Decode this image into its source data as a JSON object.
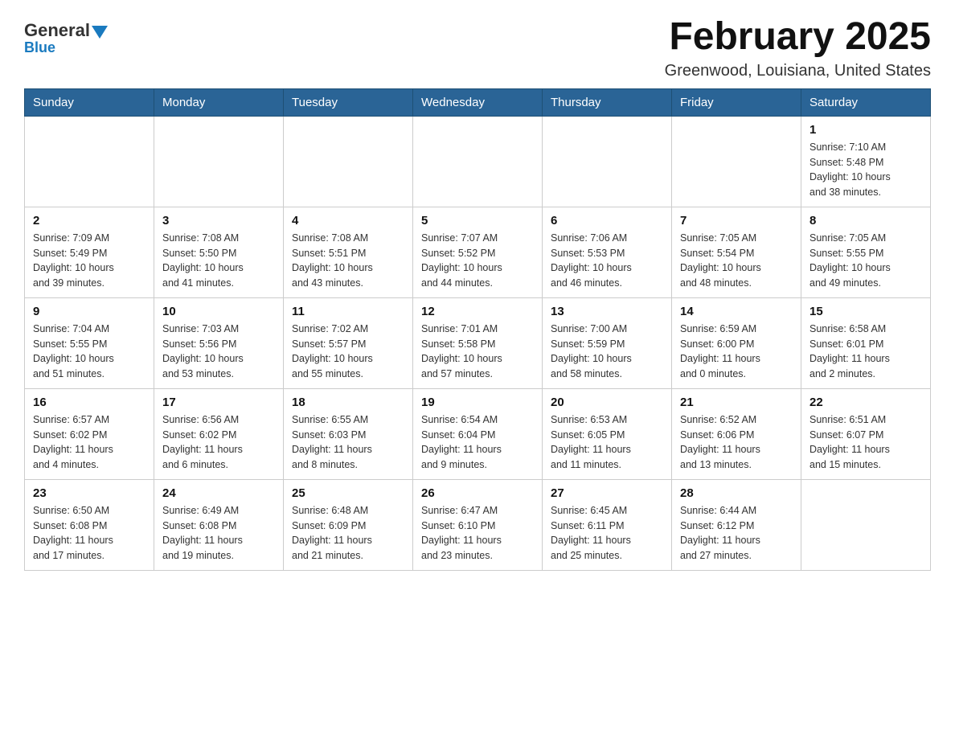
{
  "header": {
    "logo": {
      "text": "General",
      "blue": "Blue"
    },
    "title": "February 2025",
    "location": "Greenwood, Louisiana, United States"
  },
  "weekdays": [
    "Sunday",
    "Monday",
    "Tuesday",
    "Wednesday",
    "Thursday",
    "Friday",
    "Saturday"
  ],
  "weeks": [
    [
      {
        "day": "",
        "info": ""
      },
      {
        "day": "",
        "info": ""
      },
      {
        "day": "",
        "info": ""
      },
      {
        "day": "",
        "info": ""
      },
      {
        "day": "",
        "info": ""
      },
      {
        "day": "",
        "info": ""
      },
      {
        "day": "1",
        "info": "Sunrise: 7:10 AM\nSunset: 5:48 PM\nDaylight: 10 hours\nand 38 minutes."
      }
    ],
    [
      {
        "day": "2",
        "info": "Sunrise: 7:09 AM\nSunset: 5:49 PM\nDaylight: 10 hours\nand 39 minutes."
      },
      {
        "day": "3",
        "info": "Sunrise: 7:08 AM\nSunset: 5:50 PM\nDaylight: 10 hours\nand 41 minutes."
      },
      {
        "day": "4",
        "info": "Sunrise: 7:08 AM\nSunset: 5:51 PM\nDaylight: 10 hours\nand 43 minutes."
      },
      {
        "day": "5",
        "info": "Sunrise: 7:07 AM\nSunset: 5:52 PM\nDaylight: 10 hours\nand 44 minutes."
      },
      {
        "day": "6",
        "info": "Sunrise: 7:06 AM\nSunset: 5:53 PM\nDaylight: 10 hours\nand 46 minutes."
      },
      {
        "day": "7",
        "info": "Sunrise: 7:05 AM\nSunset: 5:54 PM\nDaylight: 10 hours\nand 48 minutes."
      },
      {
        "day": "8",
        "info": "Sunrise: 7:05 AM\nSunset: 5:55 PM\nDaylight: 10 hours\nand 49 minutes."
      }
    ],
    [
      {
        "day": "9",
        "info": "Sunrise: 7:04 AM\nSunset: 5:55 PM\nDaylight: 10 hours\nand 51 minutes."
      },
      {
        "day": "10",
        "info": "Sunrise: 7:03 AM\nSunset: 5:56 PM\nDaylight: 10 hours\nand 53 minutes."
      },
      {
        "day": "11",
        "info": "Sunrise: 7:02 AM\nSunset: 5:57 PM\nDaylight: 10 hours\nand 55 minutes."
      },
      {
        "day": "12",
        "info": "Sunrise: 7:01 AM\nSunset: 5:58 PM\nDaylight: 10 hours\nand 57 minutes."
      },
      {
        "day": "13",
        "info": "Sunrise: 7:00 AM\nSunset: 5:59 PM\nDaylight: 10 hours\nand 58 minutes."
      },
      {
        "day": "14",
        "info": "Sunrise: 6:59 AM\nSunset: 6:00 PM\nDaylight: 11 hours\nand 0 minutes."
      },
      {
        "day": "15",
        "info": "Sunrise: 6:58 AM\nSunset: 6:01 PM\nDaylight: 11 hours\nand 2 minutes."
      }
    ],
    [
      {
        "day": "16",
        "info": "Sunrise: 6:57 AM\nSunset: 6:02 PM\nDaylight: 11 hours\nand 4 minutes."
      },
      {
        "day": "17",
        "info": "Sunrise: 6:56 AM\nSunset: 6:02 PM\nDaylight: 11 hours\nand 6 minutes."
      },
      {
        "day": "18",
        "info": "Sunrise: 6:55 AM\nSunset: 6:03 PM\nDaylight: 11 hours\nand 8 minutes."
      },
      {
        "day": "19",
        "info": "Sunrise: 6:54 AM\nSunset: 6:04 PM\nDaylight: 11 hours\nand 9 minutes."
      },
      {
        "day": "20",
        "info": "Sunrise: 6:53 AM\nSunset: 6:05 PM\nDaylight: 11 hours\nand 11 minutes."
      },
      {
        "day": "21",
        "info": "Sunrise: 6:52 AM\nSunset: 6:06 PM\nDaylight: 11 hours\nand 13 minutes."
      },
      {
        "day": "22",
        "info": "Sunrise: 6:51 AM\nSunset: 6:07 PM\nDaylight: 11 hours\nand 15 minutes."
      }
    ],
    [
      {
        "day": "23",
        "info": "Sunrise: 6:50 AM\nSunset: 6:08 PM\nDaylight: 11 hours\nand 17 minutes."
      },
      {
        "day": "24",
        "info": "Sunrise: 6:49 AM\nSunset: 6:08 PM\nDaylight: 11 hours\nand 19 minutes."
      },
      {
        "day": "25",
        "info": "Sunrise: 6:48 AM\nSunset: 6:09 PM\nDaylight: 11 hours\nand 21 minutes."
      },
      {
        "day": "26",
        "info": "Sunrise: 6:47 AM\nSunset: 6:10 PM\nDaylight: 11 hours\nand 23 minutes."
      },
      {
        "day": "27",
        "info": "Sunrise: 6:45 AM\nSunset: 6:11 PM\nDaylight: 11 hours\nand 25 minutes."
      },
      {
        "day": "28",
        "info": "Sunrise: 6:44 AM\nSunset: 6:12 PM\nDaylight: 11 hours\nand 27 minutes."
      },
      {
        "day": "",
        "info": ""
      }
    ]
  ]
}
